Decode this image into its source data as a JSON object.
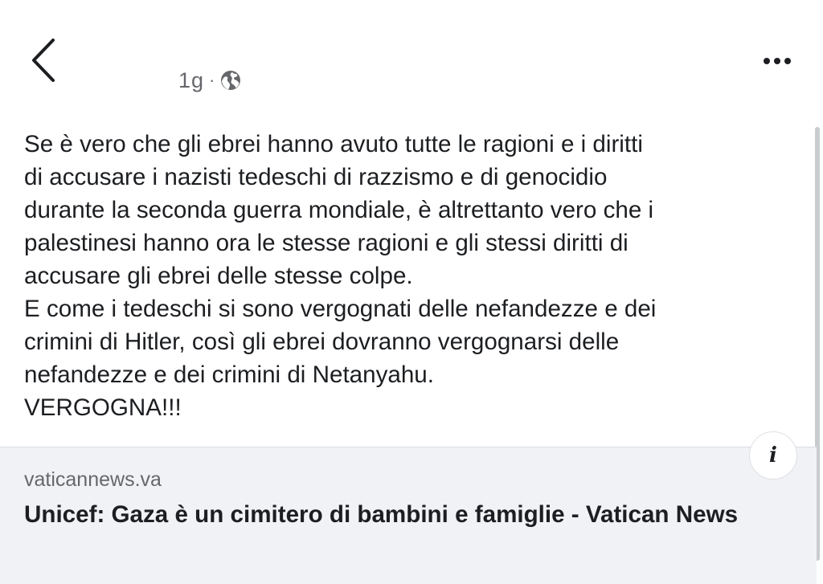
{
  "header": {
    "back_icon": "chevron-left-icon",
    "timestamp": "1g",
    "separator": "·",
    "privacy_icon": "globe-icon",
    "more_icon": "more-horizontal-icon"
  },
  "post": {
    "text": "Se è vero che gli ebrei hanno avuto tutte le ragioni e i diritti\ndi accusare i nazisti tedeschi di razzismo e di genocidio\ndurante la seconda guerra mondiale, è altrettanto vero che i\npalestinesi hanno ora le stesse ragioni e gli stessi diritti di\naccusare gli ebrei delle stesse colpe.\nE come i tedeschi si sono vergognati delle nefandezze e dei\ncrimini di Hitler, così gli ebrei dovranno vergognarsi delle\nnefandezze e dei crimini di Netanyahu.\nVERGOGNA!!!"
  },
  "link_preview": {
    "domain": "vaticannews.va",
    "title": "Unicef: Gaza è un cimitero di bambini e famiglie - Vatican News",
    "info_label": "i",
    "info_icon": "info-icon"
  },
  "colors": {
    "text": "#1c1e21",
    "secondary_text": "#65676b",
    "card_background": "#f0f2f5",
    "background": "#ffffff"
  }
}
